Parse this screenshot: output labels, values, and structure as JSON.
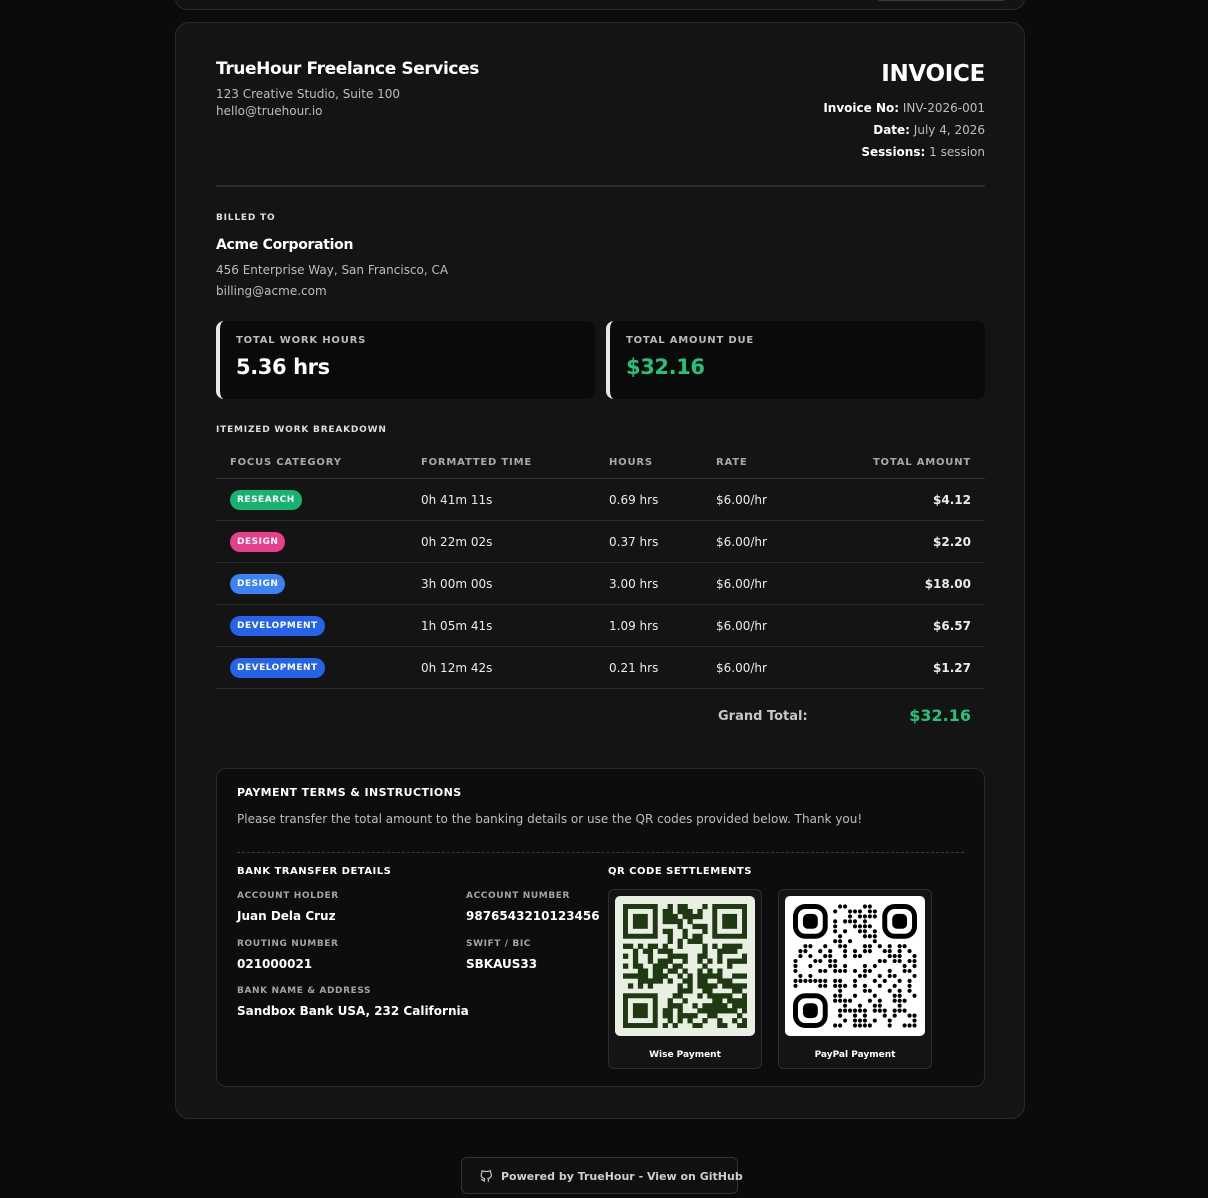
{
  "business": {
    "name": "TrueHour Freelance Services",
    "address": "123 Creative Studio, Suite 100",
    "email": "hello@truehour.io"
  },
  "invoice": {
    "title": "INVOICE",
    "number_label": "Invoice No:",
    "number": "INV-2026-001",
    "date_label": "Date:",
    "date": "July 4, 2026",
    "sessions_label": "Sessions:",
    "sessions": "1 session"
  },
  "billed_to": {
    "label": "BILLED TO",
    "name": "Acme Corporation",
    "address": "456 Enterprise Way, San Francisco, CA",
    "email": "billing@acme.com"
  },
  "summary": {
    "hours_label": "TOTAL WORK HOURS",
    "hours_value": "5.36 hrs",
    "amount_label": "TOTAL AMOUNT DUE",
    "amount_value": "$32.16"
  },
  "breakdown": {
    "label": "ITEMIZED WORK BREAKDOWN",
    "columns": [
      "FOCUS CATEGORY",
      "FORMATTED TIME",
      "HOURS",
      "RATE",
      "TOTAL AMOUNT"
    ],
    "rows": [
      {
        "category": "RESEARCH",
        "color": "#16b26f",
        "time": "0h 41m 11s",
        "hours": "0.69 hrs",
        "rate": "$6.00/hr",
        "total": "$4.12"
      },
      {
        "category": "DESIGN",
        "color": "#e83e8c",
        "time": "0h 22m 02s",
        "hours": "0.37 hrs",
        "rate": "$6.00/hr",
        "total": "$2.20"
      },
      {
        "category": "DESIGN",
        "color": "#3b82f6",
        "time": "3h 00m 00s",
        "hours": "3.00 hrs",
        "rate": "$6.00/hr",
        "total": "$18.00"
      },
      {
        "category": "DEVELOPMENT",
        "color": "#2563eb",
        "time": "1h 05m 41s",
        "hours": "1.09 hrs",
        "rate": "$6.00/hr",
        "total": "$6.57"
      },
      {
        "category": "DEVELOPMENT",
        "color": "#2563eb",
        "time": "0h 12m 42s",
        "hours": "0.21 hrs",
        "rate": "$6.00/hr",
        "total": "$1.27"
      }
    ],
    "grand_label": "Grand Total:",
    "grand_value": "$32.16"
  },
  "payment": {
    "title": "PAYMENT TERMS & INSTRUCTIONS",
    "text": "Please transfer the total amount to the banking details or use the QR codes provided below. Thank you!",
    "bank_title": "BANK TRANSFER DETAILS",
    "account_holder_label": "ACCOUNT HOLDER",
    "account_holder": "Juan Dela Cruz",
    "account_number_label": "ACCOUNT NUMBER",
    "account_number": "9876543210123456",
    "routing_label": "ROUTING NUMBER",
    "routing": "021000021",
    "swift_label": "SWIFT / BIC",
    "swift": "SBKAUS33",
    "bank_name_label": "BANK NAME & ADDRESS",
    "bank_name": "Sandbox Bank USA, 232 California",
    "qr_title": "QR CODE SETTLEMENTS",
    "qr_wise": "Wise Payment",
    "qr_paypal": "PayPal Payment"
  },
  "footer": {
    "text": "Powered by TrueHour - View on GitHub",
    "icon": "github-icon"
  },
  "colors": {
    "accent_green": "#22c47a",
    "wise_qr": "#1f3a12",
    "paypal_qr": "#000000"
  }
}
